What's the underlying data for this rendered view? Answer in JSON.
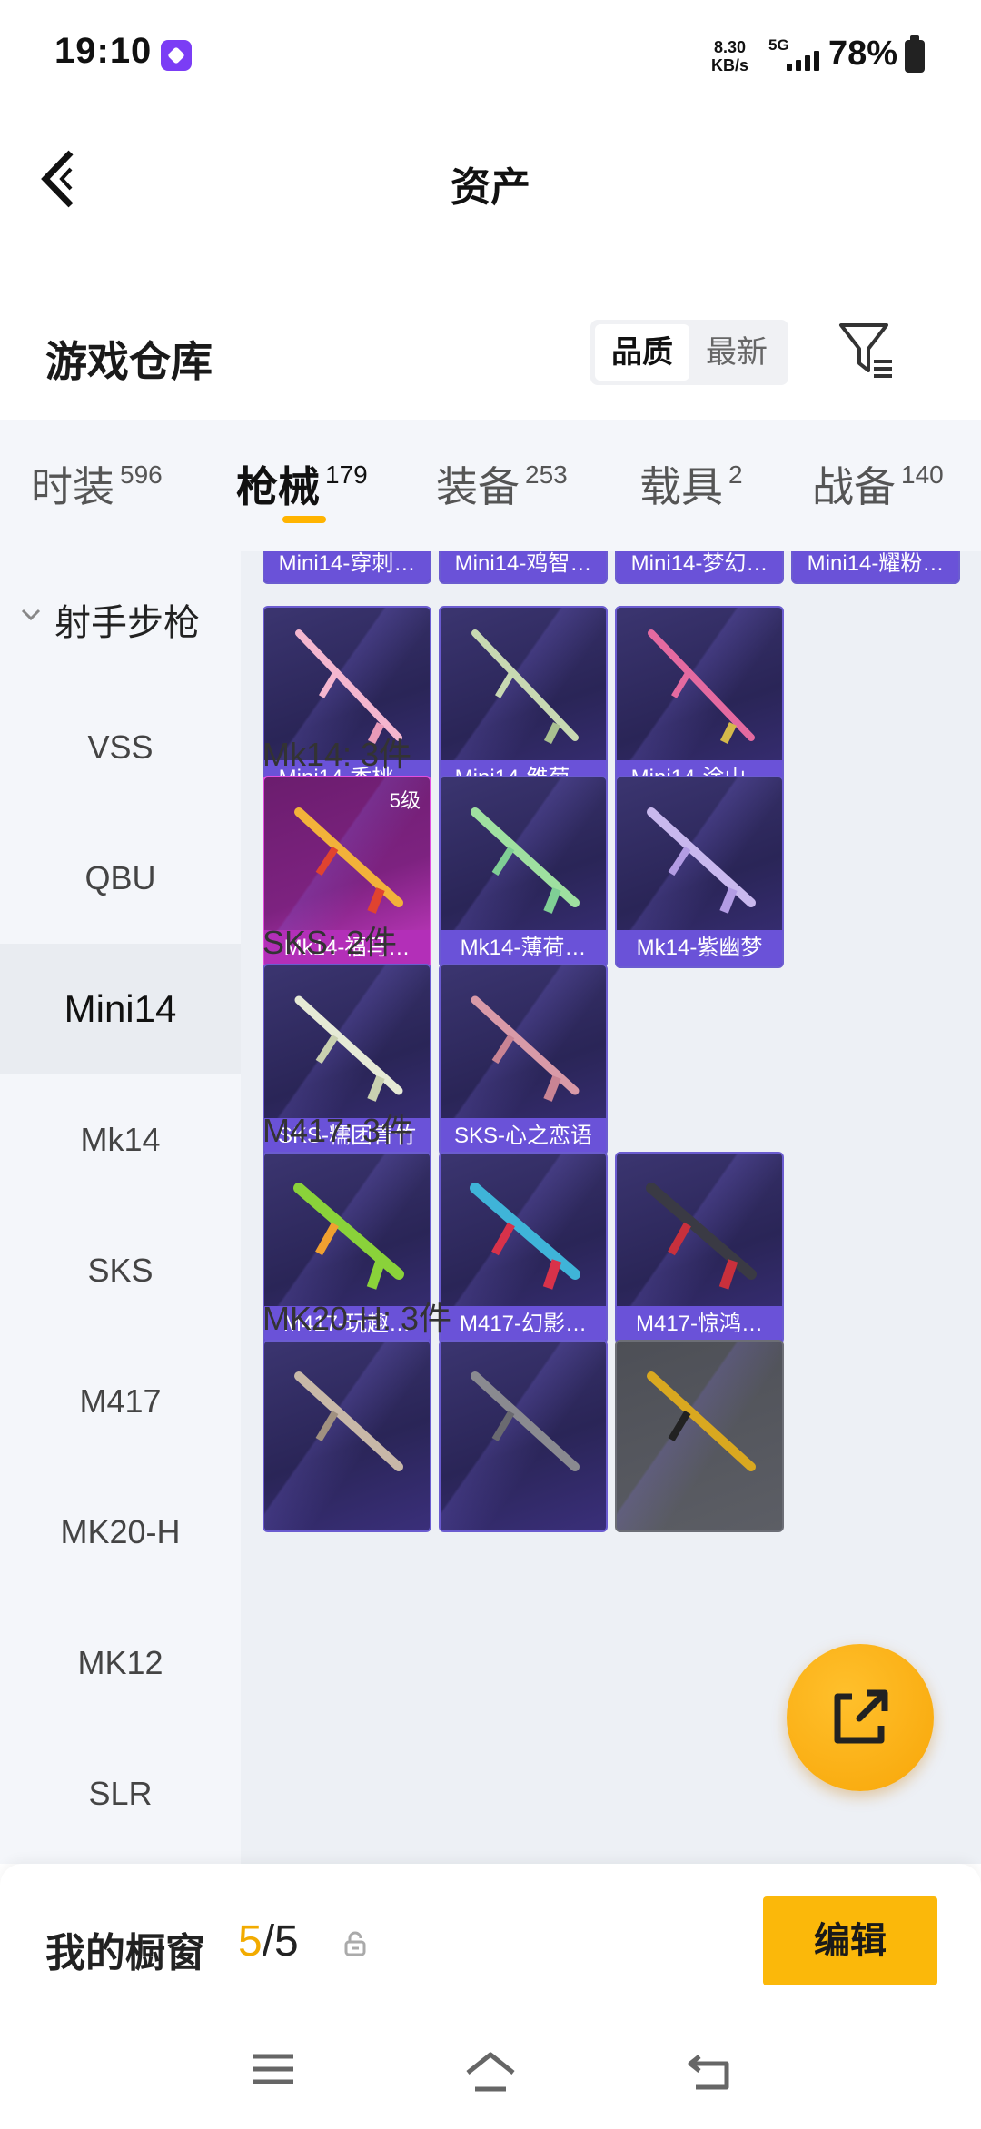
{
  "status_bar": {
    "time": "19:10",
    "net_speed_value": "8.30",
    "net_speed_unit": "KB/s",
    "network_type": "5G",
    "battery": "78%"
  },
  "header": {
    "title": "资产"
  },
  "section": {
    "title": "游戏仓库",
    "sort_options": [
      "品质",
      "最新"
    ],
    "sort_selected": "品质"
  },
  "tabs": [
    {
      "label": "时装",
      "count": "596"
    },
    {
      "label": "枪械",
      "count": "179"
    },
    {
      "label": "装备",
      "count": "253"
    },
    {
      "label": "载具",
      "count": "2"
    },
    {
      "label": "战备",
      "count": "140"
    }
  ],
  "active_tab": "枪械",
  "sidebar": {
    "group": "射手步枪",
    "items": [
      "VSS",
      "QBU",
      "Mini14",
      "Mk14",
      "SKS",
      "M417",
      "MK20-H",
      "MK12",
      "SLR"
    ],
    "active": "Mini14"
  },
  "groups": [
    {
      "title": "",
      "items": [
        "Mini14-穿刺…",
        "Mini14-鸡智…",
        "Mini14-梦幻…",
        "Mini14-耀粉…",
        "Mini14-香桃…",
        "Mini14-雏菊…",
        "Mini14-涂山…"
      ]
    },
    {
      "title": "Mk14: 3件",
      "items": [
        "Mk14-福马…",
        "Mk14-薄荷…",
        "Mk14-紫幽梦"
      ],
      "level": "5级"
    },
    {
      "title": "SKS: 2件",
      "items": [
        "SKS-糯团青竹",
        "SKS-心之恋语"
      ]
    },
    {
      "title": "M417: 3件",
      "items": [
        "M417-玩趣…",
        "M417-幻影…",
        "M417-惊鸿…"
      ]
    },
    {
      "title": "MK20-H: 3件",
      "items": [
        "",
        "",
        ""
      ]
    }
  ],
  "bottom": {
    "showcase_label": "我的橱窗",
    "current": "5",
    "separator": "/",
    "total": "5",
    "edit_label": "编辑"
  },
  "colors": {
    "accent": "#fbb80a",
    "card_purple": "#6a52d8",
    "card_pink": "#b32fb8"
  }
}
